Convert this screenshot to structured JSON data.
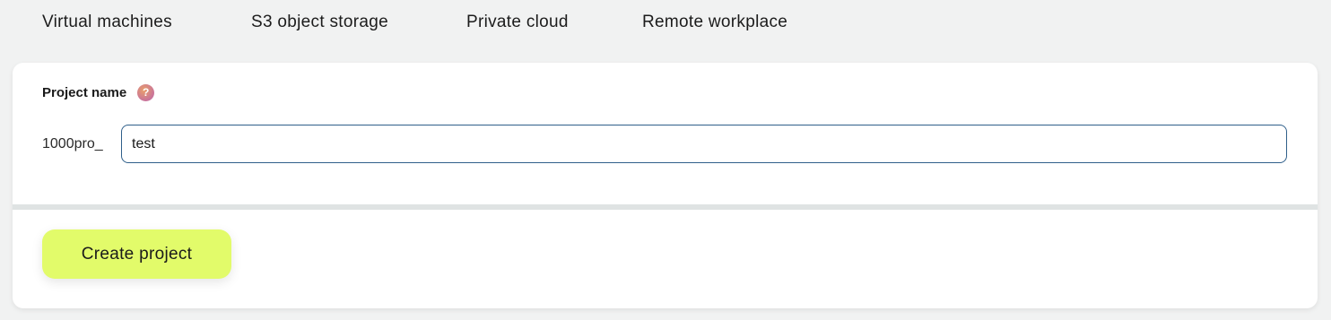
{
  "tabs": [
    {
      "label": "Virtual machines"
    },
    {
      "label": "S3 object storage"
    },
    {
      "label": "Private cloud"
    },
    {
      "label": "Remote workplace"
    }
  ],
  "form": {
    "field_label": "Project name",
    "help_icon": "question-mark-icon",
    "help_glyph": "?",
    "prefix": "1000pro_",
    "input_value": "test"
  },
  "actions": {
    "create_label": "Create project"
  },
  "colors": {
    "page_background": "#f1f2f2",
    "card_background": "#ffffff",
    "input_border": "#2f5f8a",
    "primary_button": "#e2fb6a",
    "divider": "#dfe3e3"
  }
}
